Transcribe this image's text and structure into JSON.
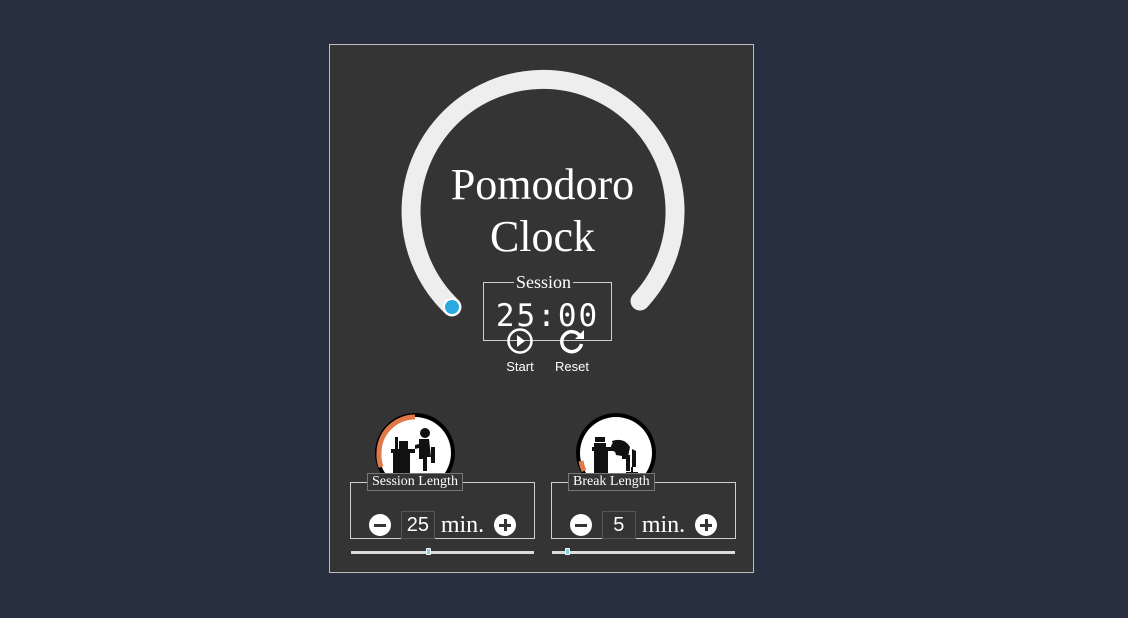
{
  "title": {
    "line1": "Pomodoro",
    "line2": "Clock"
  },
  "timer": {
    "legend": "Session",
    "display": "25:00",
    "progress": 0
  },
  "controls": {
    "start_label": "Start",
    "reset_label": "Reset"
  },
  "session": {
    "legend": "Session Length",
    "value": "25",
    "unit": "min.",
    "slider_fraction": 0.42
  },
  "break": {
    "legend": "Break Length",
    "value": "5",
    "unit": "min.",
    "slider_fraction": 0.08
  },
  "colors": {
    "background": "#283040",
    "card": "#343434",
    "ring": "#eeeeee",
    "indicator": "#29a9e0",
    "accent": "#e07848"
  },
  "icons": {
    "start": "play-circle-icon",
    "reset": "redo-icon",
    "session_avatar": "person-working-icon",
    "break_avatar": "person-resting-icon"
  }
}
